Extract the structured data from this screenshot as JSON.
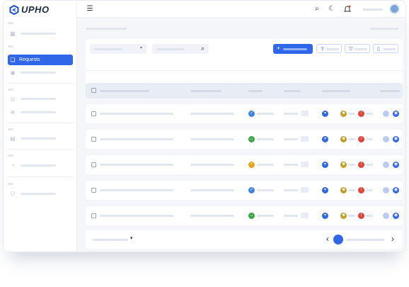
{
  "app": {
    "logo_text": "UPHO"
  },
  "sidebar": {
    "active_item_label": "Requests",
    "items": [
      {
        "icon": "grid-icon",
        "active": false
      },
      {
        "icon": "requests-icon",
        "active": true
      },
      {
        "icon": "target-icon",
        "active": false
      },
      {
        "icon": "circle-icon",
        "active": false
      },
      {
        "icon": "plus-circle-icon",
        "active": false
      },
      {
        "icon": "document-icon",
        "active": false
      },
      {
        "icon": "pie-icon",
        "active": false
      },
      {
        "icon": "user-icon",
        "active": false
      }
    ]
  },
  "topbar": {
    "menu_icon": "☰",
    "search_icon": "⌕",
    "theme_icon": "☾",
    "bell_icon": "🔔"
  },
  "toolbar": {
    "add_icon": "+",
    "colors": {
      "primary": "#2f67e8"
    }
  },
  "tabs": [
    {
      "icon": "grid-icon",
      "active": true
    },
    {
      "icon": "clock-icon",
      "active": false
    },
    {
      "icon": "refresh-icon",
      "active": false
    },
    {
      "icon": "flag-icon",
      "active": false
    }
  ],
  "rows": [
    {
      "status_color": "#3f82e8",
      "status_icon": "✓"
    },
    {
      "status_color": "#3aa843",
      "status_icon": "↔"
    },
    {
      "status_color": "#e8a51c",
      "status_icon": "•"
    },
    {
      "status_color": "#3f82e8",
      "status_icon": "✓"
    },
    {
      "status_color": "#3aa843",
      "status_icon": "↔"
    }
  ],
  "action_colors": {
    "shield": "#2f67e8",
    "lock": "#c2a128",
    "alert": "#e0453a",
    "view": "#2f67e8"
  },
  "pagination": {
    "prev": "‹",
    "next": "›"
  }
}
